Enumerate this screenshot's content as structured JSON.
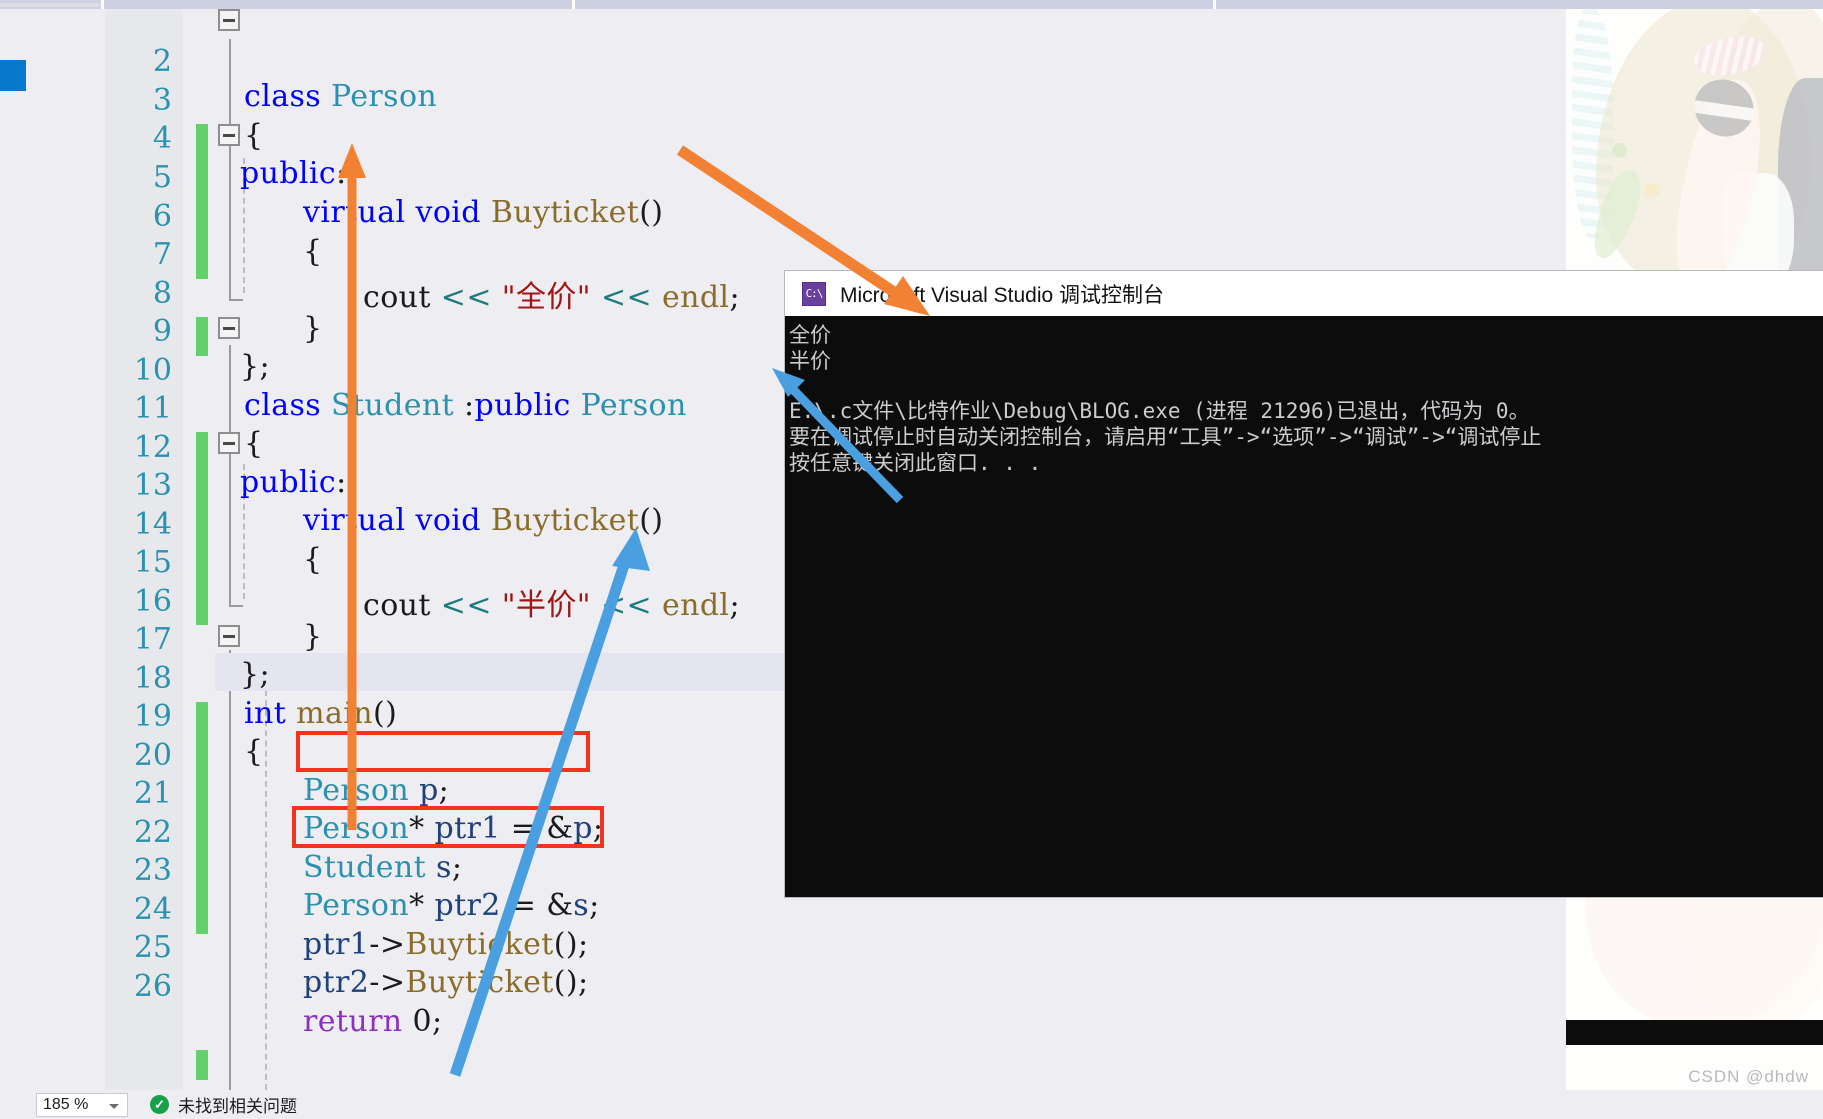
{
  "editor": {
    "zoom_level": "185 %",
    "status_message": "未找到相关问题",
    "first_visible_line": 2,
    "lines": [
      {
        "num": "2",
        "text": "class Person"
      },
      {
        "num": "3",
        "text": "{"
      },
      {
        "num": "4",
        "text": "public:"
      },
      {
        "num": "5",
        "text": "virtual void Buyticket()"
      },
      {
        "num": "6",
        "text": "{"
      },
      {
        "num": "7",
        "text": "cout << \"全价\" << endl;"
      },
      {
        "num": "8",
        "text": "}"
      },
      {
        "num": "9",
        "text": "};"
      },
      {
        "num": "10",
        "text": "class Student :public Person"
      },
      {
        "num": "11",
        "text": "{"
      },
      {
        "num": "12",
        "text": "public:"
      },
      {
        "num": "13",
        "text": "virtual void Buyticket()"
      },
      {
        "num": "14",
        "text": "{"
      },
      {
        "num": "15",
        "text": "cout << \"半价\" << endl;"
      },
      {
        "num": "16",
        "text": "}"
      },
      {
        "num": "17",
        "text": "};"
      },
      {
        "num": "18",
        "text": "int main()"
      },
      {
        "num": "19",
        "text": "{"
      },
      {
        "num": "20",
        "text": "Person p;"
      },
      {
        "num": "21",
        "text": "Person* ptr1 = &p;"
      },
      {
        "num": "22",
        "text": "Student s;"
      },
      {
        "num": "23",
        "text": "Person* ptr2 = &s;"
      },
      {
        "num": "24",
        "text": "ptr1->Buyticket();"
      },
      {
        "num": "25",
        "text": "ptr2->Buyticket();"
      },
      {
        "num": "26",
        "text": "return 0;"
      }
    ]
  },
  "console": {
    "title": "Microsoft Visual Studio 调试控制台",
    "icon_label": "C:\\",
    "output": [
      "全价",
      "半价",
      "",
      "E:\\.c文件\\比特作业\\Debug\\BLOG.exe (进程 21296)已退出，代码为 0。",
      "要在调试停止时自动关闭控制台，请启用“工具”->“选项”->“调试”->“调试停止",
      "按任意键关闭此窗口. . ."
    ]
  },
  "annotations": {
    "highlight_boxes": [
      {
        "label": "Person* ptr1 = &p;",
        "line": "21"
      },
      {
        "label": "Person* ptr2 = &s;",
        "line": "23"
      }
    ],
    "arrows": [
      {
        "color": "#F28134",
        "from": "console-output-line-1",
        "to": "code-line-5-virtual"
      },
      {
        "color": "#4A9FE0",
        "from": "console-output-line-2",
        "to": "code-line-13-Buyticket"
      }
    ],
    "colors": {
      "orange_arrow": "#F28134",
      "blue_arrow": "#4A9FE0",
      "red_box": "#F5341F",
      "change_bar_green": "#63D16B",
      "bookmark_blue": "#0878CE"
    }
  },
  "watermark": {
    "text": "CSDN @dhdw"
  }
}
